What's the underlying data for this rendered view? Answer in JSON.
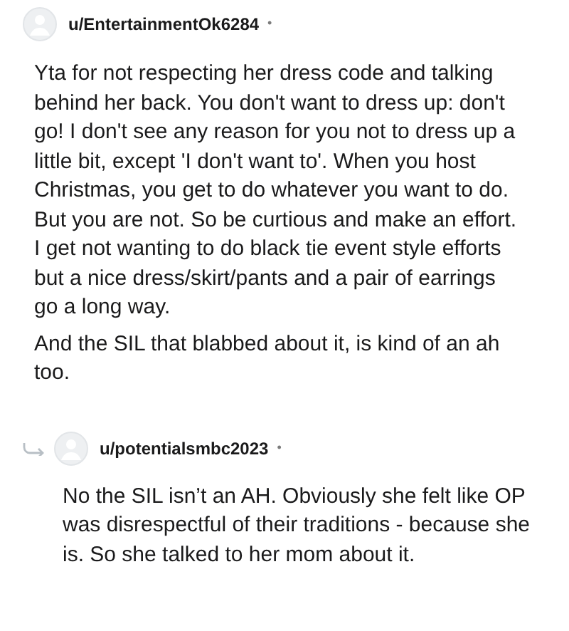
{
  "comments": [
    {
      "author": "u/EntertainmentOk6284",
      "separator": "•",
      "reply": false,
      "paragraphs": [
        "Yta for not respecting her dress code and talking behind her back. You don't want to dress up: don't go! I don't see any reason for you not to dress up a little bit, except 'I don't want to'. When you host Christmas, you get to do whatever you want to do. But you are not. So be curtious and make an effort. I get not wanting to do black tie event style efforts but a nice dress/skirt/pants and a pair of earrings go a long way.",
        "And the SIL that blabbed about it, is kind of an ah too."
      ]
    },
    {
      "author": "u/potentialsmbc2023",
      "separator": "•",
      "reply": true,
      "paragraphs": [
        "No the SIL isn’t an AH. Obviously she felt like OP was disrespectful of their traditions - because she is. So she talked to her mom about it."
      ]
    }
  ]
}
